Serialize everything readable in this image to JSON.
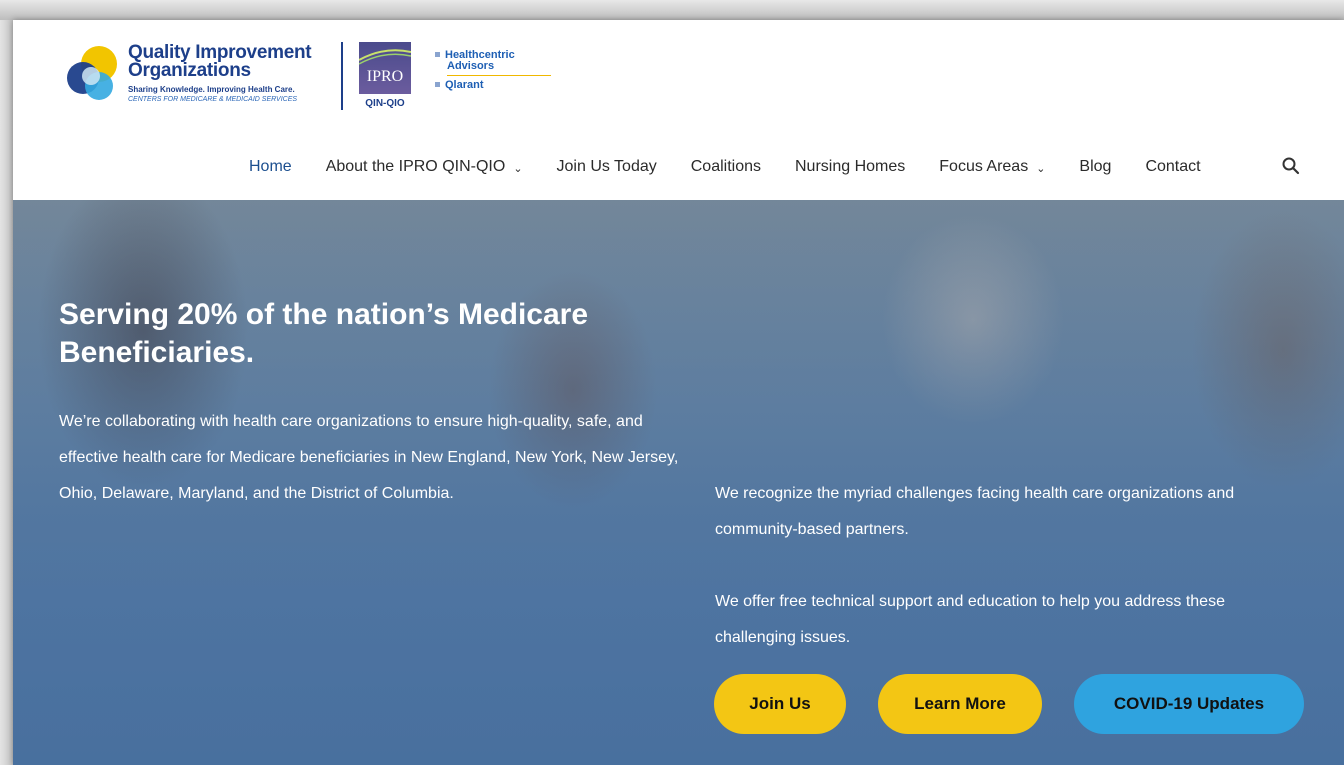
{
  "logos": {
    "qio": {
      "title_line1": "Quality Improvement",
      "title_line2": "Organizations",
      "tagline": "Sharing Knowledge. Improving Health Care.",
      "subtitle": "CENTERS FOR MEDICARE & MEDICAID SERVICES"
    },
    "ipro": {
      "box_text": "IPRO",
      "label": "QIN-QIO"
    },
    "partners": {
      "line1": "Healthcentric",
      "line2": "Advisors",
      "line3": "Qlarant"
    }
  },
  "nav": {
    "items": [
      {
        "label": "Home",
        "active": true,
        "dropdown": false
      },
      {
        "label": "About the IPRO QIN-QIO",
        "active": false,
        "dropdown": true
      },
      {
        "label": "Join Us Today",
        "active": false,
        "dropdown": false
      },
      {
        "label": "Coalitions",
        "active": false,
        "dropdown": false
      },
      {
        "label": "Nursing Homes",
        "active": false,
        "dropdown": false
      },
      {
        "label": "Focus Areas",
        "active": false,
        "dropdown": true
      },
      {
        "label": "Blog",
        "active": false,
        "dropdown": false
      },
      {
        "label": "Contact",
        "active": false,
        "dropdown": false
      }
    ],
    "search_icon": "search-icon"
  },
  "hero": {
    "title": "Serving 20% of the nation’s Medicare Beneficiaries.",
    "body": "We’re collaborating with health care organizations to ensure high-quality, safe, and effective health care for Medicare beneficiaries in New England, New York, New Jersey, Ohio, Delaware, Maryland, and the District of Columbia.",
    "right_p1": "We recognize the myriad challenges facing health care organizations and community-based partners.",
    "right_p2": "We offer free technical support and education to help you address these challenging issues.",
    "buttons": {
      "join": "Join Us",
      "learn": "Learn More",
      "covid": "COVID-19 Updates"
    }
  },
  "colors": {
    "nav_active": "#1c4f8f",
    "button_yellow": "#f3c614",
    "button_blue": "#2fa3df",
    "brand_navy": "#1d3f8a"
  }
}
